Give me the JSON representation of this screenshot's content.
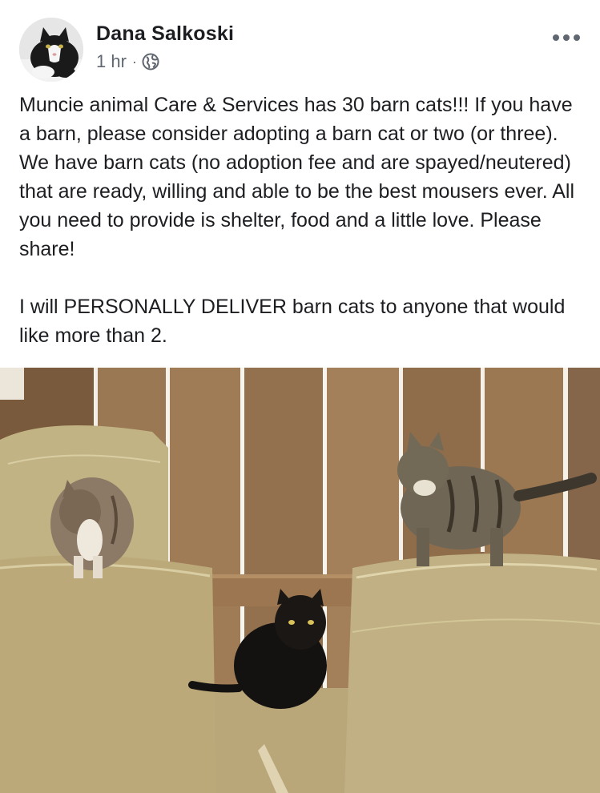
{
  "author": {
    "name": "Dana Salkoski",
    "avatar_icon": "cat-avatar-icon"
  },
  "meta": {
    "time": "1 hr",
    "separator": "·",
    "audience_icon": "globe-icon"
  },
  "menu": {
    "more_icon": "more-horizontal-icon"
  },
  "post": {
    "paragraphs": [
      "Muncie animal Care & Services has 30 barn cats!!! If you have a barn, please consider adopting a barn cat or two (or three). We have barn cats (no adoption fee and are spayed/neutered) that are ready, willing and able to be the best mousers ever. All you need to provide is shelter, food and a little love. Please share!",
      "I will PERSONALLY DELIVER barn cats to anyone that would like more than 2."
    ]
  },
  "photo": {
    "subject_icon": "barn-cats-photo"
  },
  "colors": {
    "text_primary": "#1c1e21",
    "text_secondary": "#606770",
    "background": "#ffffff"
  }
}
